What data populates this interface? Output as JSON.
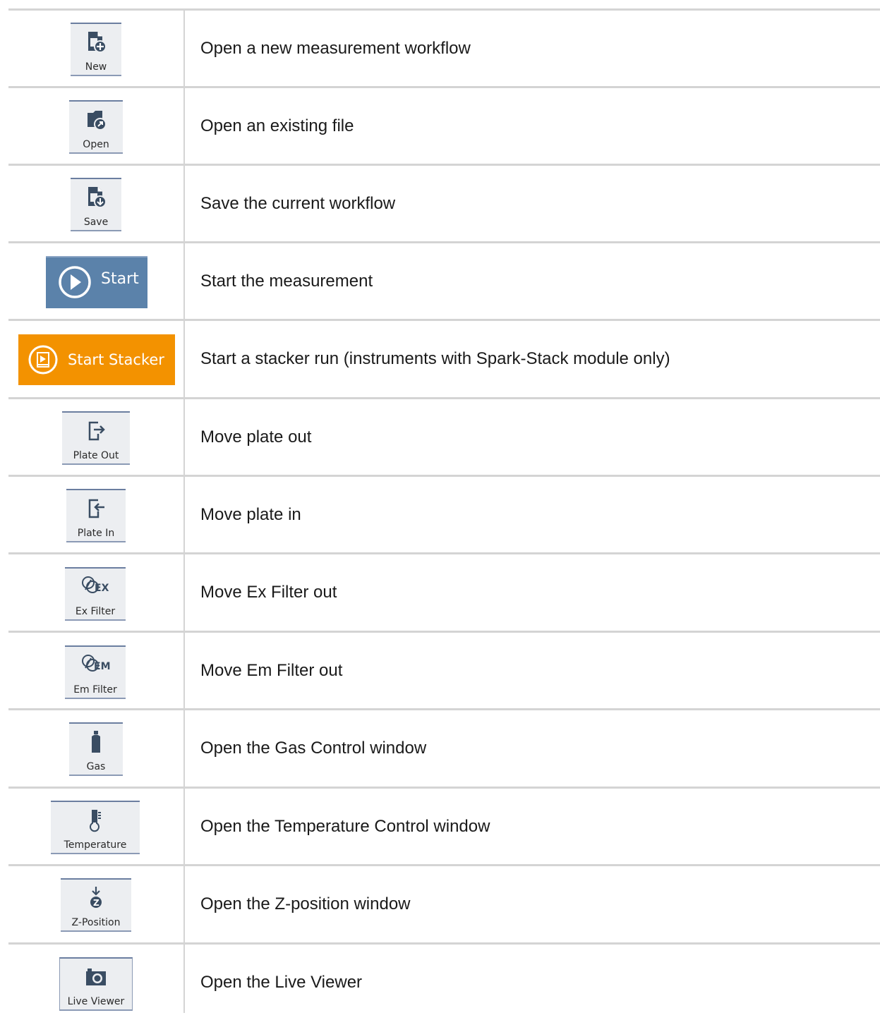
{
  "rows": [
    {
      "icon": "new-file-icon",
      "label": "New",
      "description": "Open a new measurement workflow"
    },
    {
      "icon": "open-file-icon",
      "label": "Open",
      "description": "Open an existing file"
    },
    {
      "icon": "save-file-icon",
      "label": "Save",
      "description": "Save the current workflow"
    },
    {
      "icon": "play-icon",
      "label": "Start",
      "description": "Start the measurement"
    },
    {
      "icon": "stacker-play-icon",
      "label": "Start Stacker",
      "description": "Start a stacker run (instruments with Spark-Stack module only)"
    },
    {
      "icon": "plate-out-icon",
      "label": "Plate Out",
      "description": "Move plate out"
    },
    {
      "icon": "plate-in-icon",
      "label": "Plate In",
      "description": "Move plate in"
    },
    {
      "icon": "ex-filter-icon",
      "label": "Ex Filter",
      "description": "Move Ex Filter out"
    },
    {
      "icon": "em-filter-icon",
      "label": "Em Filter",
      "description": "Move Em Filter out"
    },
    {
      "icon": "gas-bottle-icon",
      "label": "Gas",
      "description": "Open the Gas Control window"
    },
    {
      "icon": "thermometer-icon",
      "label": "Temperature",
      "description": "Open the Temperature Control window"
    },
    {
      "icon": "z-position-icon",
      "label": "Z-Position",
      "description": "Open the Z-position window"
    },
    {
      "icon": "camera-icon",
      "label": "Live Viewer",
      "description": "Open the Live Viewer"
    }
  ],
  "colors": {
    "start_blue": "#5b82aa",
    "stacker_orange": "#f39200",
    "icon_dark": "#3a4d63",
    "grid": "#d4d4d4"
  }
}
